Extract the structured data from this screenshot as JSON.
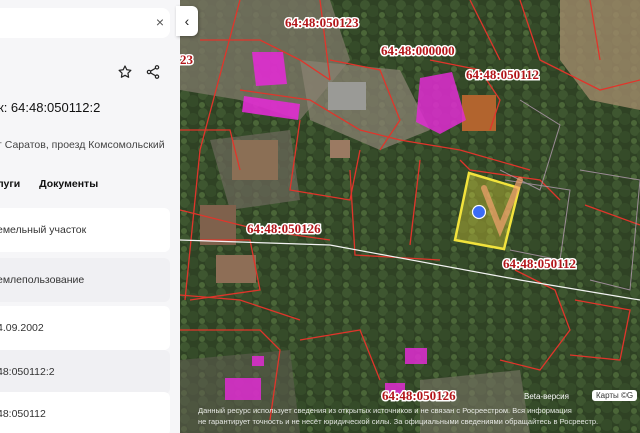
{
  "panel": {
    "close_glyph": "×",
    "title": "к: 64:48:050112:2",
    "address": "г Саратов, проезд Комсомольский",
    "tabs": [
      "луги",
      "Документы"
    ],
    "rows": [
      "емельный участок",
      "емлепользование",
      "4.09.2002",
      "48:050112:2",
      "48:050112"
    ],
    "collapse_glyph": "‹"
  },
  "map": {
    "labels": [
      {
        "text": "64:48:050123"
      },
      {
        "text": "64:48:000000"
      },
      {
        "text": "64:48:050112"
      },
      {
        "text": "64:48:050126"
      },
      {
        "text": "64:48:050112"
      },
      {
        "text": "64:48:050126"
      },
      {
        "text": "23"
      }
    ],
    "beta": "Beta-версия",
    "attribution": "Карты ©G",
    "disclaimer_1": "Данный ресурс использует сведения из открытых источников и не связан с Росреестром. Вся информация",
    "disclaimer_2": "не гарантирует точность и не несёт юридической силы. За официальными сведениями обращайтесь в Росреестр."
  },
  "colors": {
    "label": "#b3161a",
    "boundary": "#e0352b",
    "selected": "#f2e33c",
    "building": "#e12cd2"
  }
}
